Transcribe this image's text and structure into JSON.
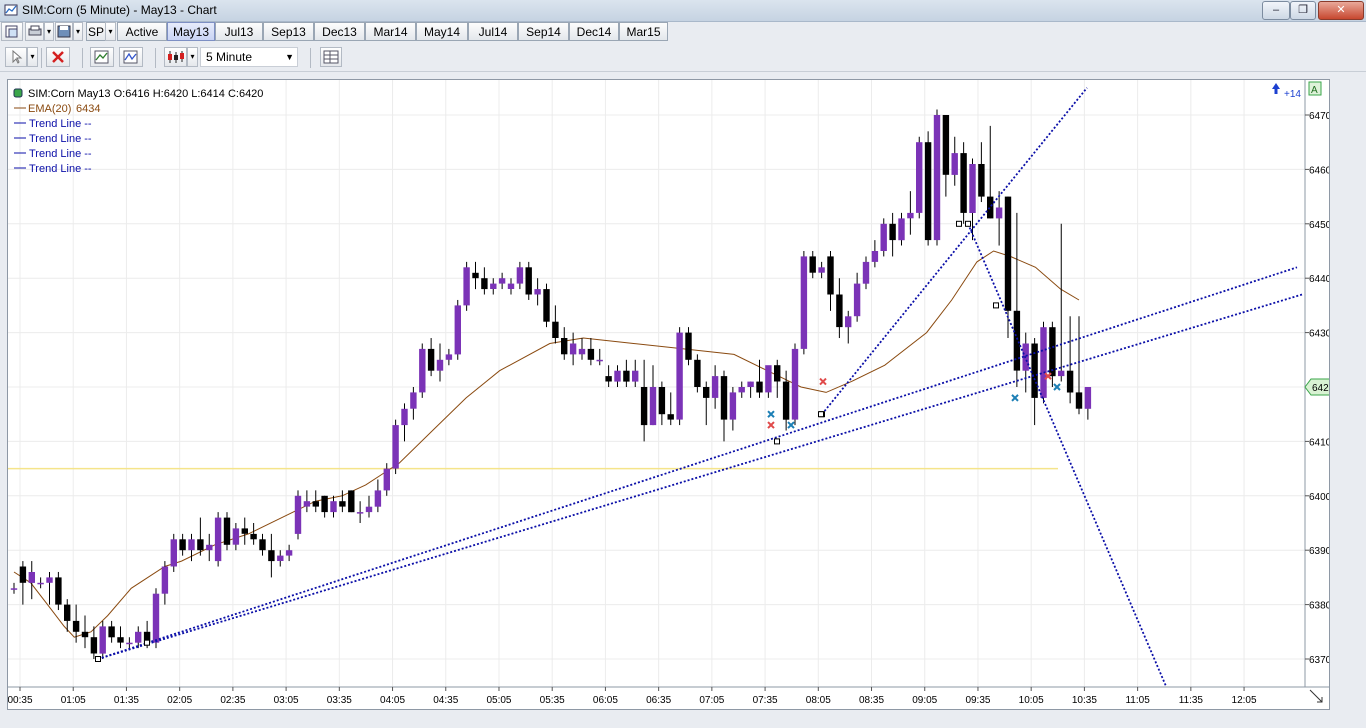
{
  "window": {
    "title": "SIM:Corn (5 Minute) - May13 - Chart",
    "controls": [
      "‒",
      "❐",
      "✕"
    ]
  },
  "tabs": {
    "instrument": "SP",
    "items": [
      "Active",
      "May13",
      "Jul13",
      "Sep13",
      "Dec13",
      "Mar14",
      "May14",
      "Jul14",
      "Sep14",
      "Dec14",
      "Mar15"
    ],
    "selected": "May13"
  },
  "toolbar": {
    "interval": "5 Minute",
    "icons": [
      "cursor-icon",
      "delete-icon",
      "indicators-icon",
      "strategies-icon",
      "chart-style-icon",
      "data-box-icon"
    ]
  },
  "legend": {
    "instrument": "SIM:Corn May13 O:6416 H:6420 L:6414 C:6420",
    "ema": "EMA(20)",
    "ema_value": "6434",
    "trend_lines": [
      "Trend Line  --",
      "Trend Line  --",
      "Trend Line  --",
      "Trend Line  --"
    ]
  },
  "corner": {
    "badge": "A",
    "counter": "+14"
  },
  "colors": {
    "up_candle": "#7b33b7",
    "down_candle": "#000000",
    "ema": "#8a4a10",
    "trend_line": "#0b0fa8",
    "horizontal_line": "#f5e48a",
    "last_price_tag": "#d9f2d3"
  },
  "chart_data": {
    "type": "candlestick",
    "title": "SIM:Corn May13",
    "last_price": 6420,
    "y_range": [
      6365,
      6475
    ],
    "y_ticks": [
      6370,
      6380,
      6390,
      6400,
      6410,
      6420,
      6430,
      6440,
      6450,
      6460,
      6470
    ],
    "x_ticks": [
      "00:35",
      "01:05",
      "01:35",
      "02:05",
      "02:35",
      "03:05",
      "03:35",
      "04:05",
      "04:35",
      "05:05",
      "05:35",
      "06:05",
      "06:35",
      "07:05",
      "07:35",
      "08:05",
      "08:35",
      "09:05",
      "09:35",
      "10:05",
      "10:35",
      "11:05",
      "11:35",
      "12:05"
    ],
    "horizontal_line": 6405,
    "candles": [
      [
        6383,
        6384,
        6382,
        6383
      ],
      [
        6387,
        6388,
        6380,
        6384
      ],
      [
        6384,
        6388,
        6381,
        6386
      ],
      [
        6384,
        6385,
        6383,
        6384
      ],
      [
        6384,
        6386,
        6380,
        6385
      ],
      [
        6385,
        6386,
        6379,
        6380
      ],
      [
        6380,
        6381,
        6375,
        6377
      ],
      [
        6377,
        6380,
        6373,
        6375
      ],
      [
        6375,
        6378,
        6372,
        6374
      ],
      [
        6374,
        6376,
        6370,
        6371
      ],
      [
        6371,
        6377,
        6370,
        6376
      ],
      [
        6376,
        6377,
        6373,
        6374
      ],
      [
        6374,
        6376,
        6372,
        6373
      ],
      [
        6373,
        6374,
        6372,
        6373
      ],
      [
        6373,
        6376,
        6372,
        6375
      ],
      [
        6375,
        6377,
        6372,
        6373
      ],
      [
        6373,
        6383,
        6372,
        6382
      ],
      [
        6382,
        6388,
        6380,
        6387
      ],
      [
        6387,
        6393,
        6386,
        6392
      ],
      [
        6392,
        6393,
        6389,
        6390
      ],
      [
        6390,
        6393,
        6388,
        6392
      ],
      [
        6392,
        6396,
        6389,
        6390
      ],
      [
        6390,
        6393,
        6388,
        6391
      ],
      [
        6388,
        6397,
        6387,
        6396
      ],
      [
        6396,
        6397,
        6390,
        6391
      ],
      [
        6391,
        6395,
        6390,
        6394
      ],
      [
        6394,
        6396,
        6391,
        6393
      ],
      [
        6393,
        6395,
        6391,
        6392
      ],
      [
        6392,
        6393,
        6389,
        6390
      ],
      [
        6390,
        6393,
        6385,
        6388
      ],
      [
        6388,
        6390,
        6387,
        6389
      ],
      [
        6389,
        6391,
        6388,
        6390
      ],
      [
        6393,
        6401,
        6392,
        6400
      ],
      [
        6398,
        6401,
        6397,
        6399
      ],
      [
        6399,
        6401,
        6397,
        6398
      ],
      [
        6400,
        6400,
        6396,
        6397
      ],
      [
        6397,
        6400,
        6396,
        6399
      ],
      [
        6399,
        6401,
        6397,
        6398
      ],
      [
        6401,
        6401,
        6397,
        6397
      ],
      [
        6397,
        6399,
        6395,
        6397
      ],
      [
        6397,
        6400,
        6396,
        6398
      ],
      [
        6398,
        6403,
        6397,
        6401
      ],
      [
        6401,
        6406,
        6400,
        6405
      ],
      [
        6405,
        6414,
        6404,
        6413
      ],
      [
        6413,
        6417,
        6410,
        6416
      ],
      [
        6416,
        6420,
        6414,
        6419
      ],
      [
        6419,
        6428,
        6418,
        6427
      ],
      [
        6427,
        6429,
        6422,
        6423
      ],
      [
        6423,
        6428,
        6421,
        6425
      ],
      [
        6425,
        6427,
        6424,
        6426
      ],
      [
        6426,
        6436,
        6425,
        6435
      ],
      [
        6435,
        6443,
        6434,
        6442
      ],
      [
        6441,
        6443,
        6438,
        6440
      ],
      [
        6440,
        6442,
        6437,
        6438
      ],
      [
        6438,
        6440,
        6437,
        6439
      ],
      [
        6439,
        6441,
        6438,
        6440
      ],
      [
        6438,
        6440,
        6437,
        6439
      ],
      [
        6439,
        6443,
        6438,
        6442
      ],
      [
        6442,
        6443,
        6436,
        6437
      ],
      [
        6437,
        6440,
        6435,
        6438
      ],
      [
        6438,
        6439,
        6431,
        6432
      ],
      [
        6432,
        6435,
        6428,
        6429
      ],
      [
        6429,
        6431,
        6425,
        6426
      ],
      [
        6426,
        6430,
        6424,
        6428
      ],
      [
        6426,
        6429,
        6425,
        6427
      ],
      [
        6427,
        6429,
        6424,
        6425
      ],
      [
        6425,
        6427,
        6424,
        6425
      ],
      [
        6422,
        6424,
        6420,
        6421
      ],
      [
        6421,
        6424,
        6420,
        6423
      ],
      [
        6423,
        6425,
        6420,
        6421
      ],
      [
        6421,
        6425,
        6420,
        6423
      ],
      [
        6420,
        6425,
        6410,
        6413
      ],
      [
        6413,
        6424,
        6413,
        6420
      ],
      [
        6420,
        6421,
        6413,
        6415
      ],
      [
        6415,
        6419,
        6413,
        6414
      ],
      [
        6414,
        6431,
        6413,
        6430
      ],
      [
        6430,
        6431,
        6424,
        6425
      ],
      [
        6425,
        6426,
        6419,
        6420
      ],
      [
        6420,
        6421,
        6413,
        6418
      ],
      [
        6418,
        6424,
        6416,
        6422
      ],
      [
        6422,
        6423,
        6410,
        6414
      ],
      [
        6414,
        6420,
        6412,
        6419
      ],
      [
        6419,
        6421,
        6418,
        6420
      ],
      [
        6420,
        6421,
        6418,
        6421
      ],
      [
        6421,
        6425,
        6418,
        6419
      ],
      [
        6419,
        6423,
        6418,
        6424
      ],
      [
        6424,
        6425,
        6418,
        6421
      ],
      [
        6421,
        6423,
        6412,
        6414
      ],
      [
        6414,
        6428,
        6413,
        6427
      ],
      [
        6427,
        6445,
        6426,
        6444
      ],
      [
        6444,
        6445,
        6440,
        6441
      ],
      [
        6441,
        6443,
        6440,
        6442
      ],
      [
        6444,
        6445,
        6434,
        6437
      ],
      [
        6437,
        6440,
        6429,
        6431
      ],
      [
        6431,
        6434,
        6428,
        6433
      ],
      [
        6433,
        6441,
        6432,
        6439
      ],
      [
        6439,
        6444,
        6438,
        6443
      ],
      [
        6443,
        6447,
        6442,
        6445
      ],
      [
        6445,
        6451,
        6444,
        6450
      ],
      [
        6450,
        6452,
        6444,
        6447
      ],
      [
        6447,
        6452,
        6446,
        6451
      ],
      [
        6451,
        6456,
        6448,
        6452
      ],
      [
        6452,
        6466,
        6451,
        6465
      ],
      [
        6465,
        6467,
        6446,
        6447
      ],
      [
        6447,
        6471,
        6446,
        6470
      ],
      [
        6470,
        6470,
        6455,
        6459
      ],
      [
        6459,
        6466,
        6457,
        6463
      ],
      [
        6463,
        6465,
        6450,
        6452
      ],
      [
        6452,
        6462,
        6447,
        6461
      ],
      [
        6461,
        6465,
        6454,
        6455
      ],
      [
        6455,
        6468,
        6451,
        6451
      ],
      [
        6451,
        6456,
        6446,
        6453
      ],
      [
        6455,
        6455,
        6429,
        6434
      ],
      [
        6434,
        6452,
        6420,
        6423
      ],
      [
        6423,
        6430,
        6419,
        6428
      ],
      [
        6428,
        6429,
        6413,
        6418
      ],
      [
        6418,
        6432,
        6417,
        6431
      ],
      [
        6431,
        6432,
        6420,
        6422
      ],
      [
        6422,
        6450,
        6421,
        6423
      ],
      [
        6423,
        6433,
        6417,
        6419
      ],
      [
        6419,
        6433,
        6415,
        6416
      ],
      [
        6416,
        6420,
        6414,
        6420
      ]
    ],
    "ema20": [
      [
        0,
        6386
      ],
      [
        10,
        6384
      ],
      [
        20,
        6380
      ],
      [
        30,
        6376
      ],
      [
        36,
        6374
      ],
      [
        46,
        6375
      ],
      [
        56,
        6378
      ],
      [
        70,
        6383
      ],
      [
        90,
        6387
      ],
      [
        100,
        6388
      ],
      [
        120,
        6391
      ],
      [
        140,
        6393
      ],
      [
        160,
        6396
      ],
      [
        180,
        6399
      ],
      [
        196,
        6400
      ],
      [
        210,
        6402
      ],
      [
        230,
        6406
      ],
      [
        250,
        6412
      ],
      [
        270,
        6418
      ],
      [
        290,
        6423
      ],
      [
        320,
        6428
      ],
      [
        340,
        6429
      ],
      [
        370,
        6428
      ],
      [
        400,
        6427
      ],
      [
        430,
        6426
      ],
      [
        450,
        6423
      ],
      [
        470,
        6420
      ],
      [
        485,
        6419
      ],
      [
        500,
        6421
      ],
      [
        520,
        6424
      ],
      [
        545,
        6430
      ],
      [
        560,
        6436
      ],
      [
        575,
        6443
      ],
      [
        585,
        6445
      ],
      [
        595,
        6444
      ],
      [
        610,
        6442
      ],
      [
        625,
        6438
      ],
      [
        636,
        6436
      ]
    ],
    "trend_lines": [
      {
        "from": [
          83,
          6370
        ],
        "to": [
          1301,
          6437
        ]
      },
      {
        "from": [
          83,
          6370
        ],
        "to": [
          1296,
          6442
        ]
      },
      {
        "from": [
          807,
          6415
        ],
        "to": [
          1086,
          6475
        ]
      },
      {
        "from": [
          953,
          6450
        ],
        "to": [
          1165,
          6365
        ]
      }
    ],
    "markers": [
      {
        "x": 763,
        "y": 6415,
        "color": "#1c7fb5"
      },
      {
        "x": 763,
        "y": 6413,
        "color": "#e04a4a"
      },
      {
        "x": 783,
        "y": 6413,
        "color": "#1c7fb5"
      },
      {
        "x": 815,
        "y": 6421,
        "color": "#e04a4a"
      },
      {
        "x": 1007,
        "y": 6418,
        "color": "#1c7fb5"
      },
      {
        "x": 1040,
        "y": 6422,
        "color": "#e04a4a"
      },
      {
        "x": 1049,
        "y": 6420,
        "color": "#1c7fb5"
      }
    ]
  }
}
